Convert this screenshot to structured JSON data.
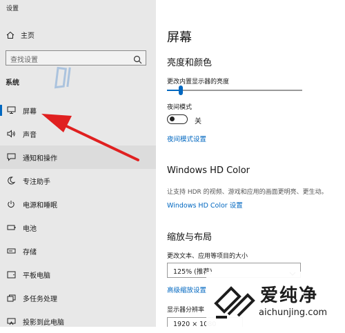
{
  "window": {
    "title": "设置"
  },
  "sidebar": {
    "home_label": "主页",
    "search_placeholder": "查找设置",
    "section_label": "系统",
    "items": [
      {
        "label": "屏幕",
        "icon": "monitor-icon",
        "selected": true
      },
      {
        "label": "声音",
        "icon": "speaker-icon"
      },
      {
        "label": "通知和操作",
        "icon": "notification-icon"
      },
      {
        "label": "专注助手",
        "icon": "moon-icon"
      },
      {
        "label": "电源和睡眠",
        "icon": "power-icon"
      },
      {
        "label": "电池",
        "icon": "battery-icon"
      },
      {
        "label": "存储",
        "icon": "storage-icon"
      },
      {
        "label": "平板电脑",
        "icon": "tablet-icon"
      },
      {
        "label": "多任务处理",
        "icon": "multitask-icon"
      },
      {
        "label": "投影到此电脑",
        "icon": "projector-icon"
      }
    ]
  },
  "main": {
    "title": "屏幕",
    "brightness": {
      "heading": "亮度和颜色",
      "slider_label": "更改内置显示器的亮度",
      "slider_value": 0.1,
      "night_mode_label": "夜间模式",
      "night_mode_state": "关",
      "night_mode_link": "夜间模式设置"
    },
    "hdr": {
      "heading": "Windows HD Color",
      "description": "让支持 HDR 的视频、游戏和应用的画面更明亮、更生动。",
      "link": "Windows HD Color 设置"
    },
    "scale": {
      "heading": "缩放与布局",
      "size_label": "更改文本、应用等项目的大小",
      "size_value": "125% (推荐)",
      "advanced_link": "高级缩放设置",
      "resolution_label": "显示器分辨率",
      "resolution_value": "1920 × 1080"
    }
  },
  "watermark": {
    "text": "爱纯净",
    "url": "aichunjing.com"
  },
  "colors": {
    "accent": "#0067c0",
    "arrow": "#e02020",
    "sidebar_bg": "#e8e8e8"
  }
}
